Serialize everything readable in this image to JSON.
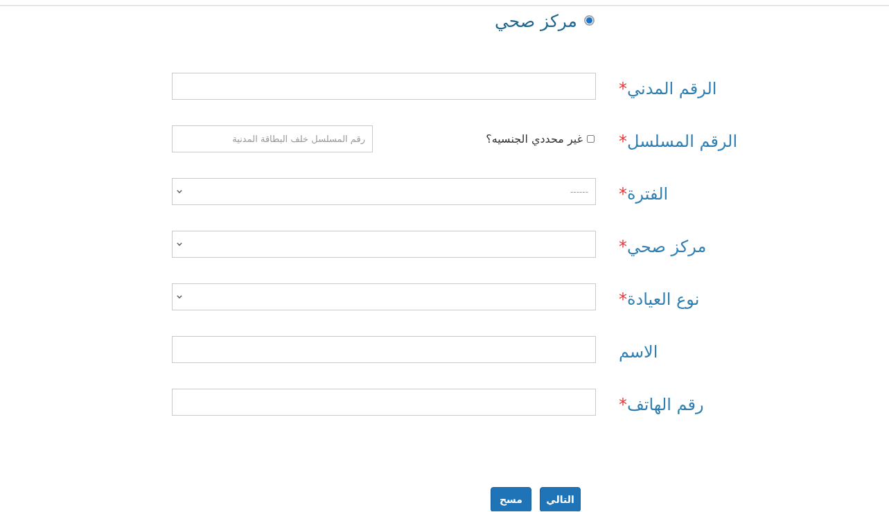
{
  "center_option": {
    "label": "مركز صحي",
    "selected": true
  },
  "fields": [
    {
      "kind": "text",
      "label": "الرقم المدني",
      "required_mark": "*"
    },
    {
      "kind": "text",
      "label": "الرقم المسلسل",
      "required_mark": "*",
      "placeholder": "رقم المسلسل خلف البطاقة المدنية",
      "checkbox": {
        "label": "غير محددي الجنسيه؟",
        "checked": false
      }
    },
    {
      "kind": "select",
      "label": "الفترة",
      "required_mark": "*",
      "value": "------"
    },
    {
      "kind": "select",
      "label": "مركز صحي",
      "required_mark": "*"
    },
    {
      "kind": "select",
      "label": "نوع العيادة",
      "required_mark": "*"
    },
    {
      "kind": "text",
      "label": "الاسم"
    },
    {
      "kind": "text",
      "label": "رقم الهاتف",
      "required_mark": "*"
    }
  ],
  "buttons": [
    {
      "label": "التالي"
    },
    {
      "label": "مسح"
    }
  ]
}
